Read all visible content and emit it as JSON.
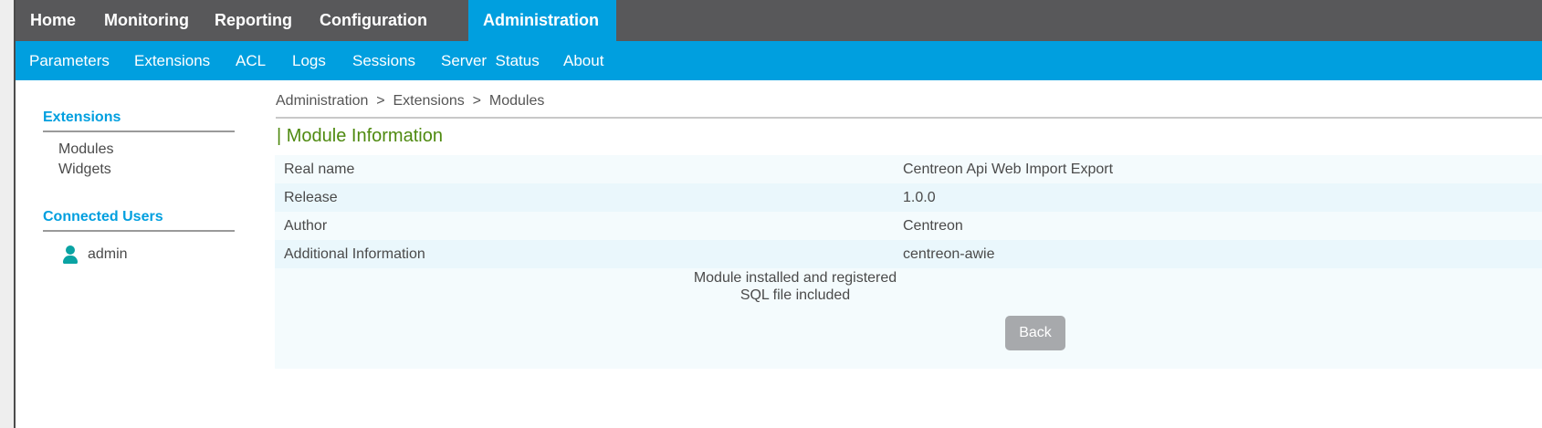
{
  "top_menu": {
    "items": [
      {
        "label": "Home"
      },
      {
        "label": "Monitoring"
      },
      {
        "label": "Reporting"
      },
      {
        "label": "Configuration"
      },
      {
        "label": "Administration",
        "active": true
      }
    ]
  },
  "sub_menu": {
    "items": [
      {
        "label": "Parameters"
      },
      {
        "label": "Extensions"
      },
      {
        "label": "ACL"
      },
      {
        "label": "Logs"
      },
      {
        "label": "Sessions"
      },
      {
        "label": "Server  Status"
      },
      {
        "label": "About"
      }
    ]
  },
  "sidebar": {
    "extensions_title": "Extensions",
    "extensions_items": [
      {
        "label": "Modules"
      },
      {
        "label": "Widgets"
      }
    ],
    "connected_users_title": "Connected Users",
    "users": [
      {
        "name": "admin",
        "icon": "user-icon"
      }
    ]
  },
  "breadcrumb": {
    "items": [
      "Administration",
      "Extensions",
      "Modules"
    ],
    "separator": ">"
  },
  "module_info": {
    "title": "| Module Information",
    "rows": [
      {
        "label": "Real name",
        "value": "Centreon Api Web Import Export"
      },
      {
        "label": "Release",
        "value": "1.0.0"
      },
      {
        "label": "Author",
        "value": "Centreon"
      },
      {
        "label": "Additional Information",
        "value": "centreon-awie"
      }
    ],
    "status_lines": [
      "Module installed and registered",
      "SQL file included"
    ],
    "back_label": "Back"
  },
  "colors": {
    "top_menu_bg": "#58585a",
    "accent": "#009fdf",
    "section_title": "#4f8a10",
    "button_bg": "#a7a9ac"
  }
}
